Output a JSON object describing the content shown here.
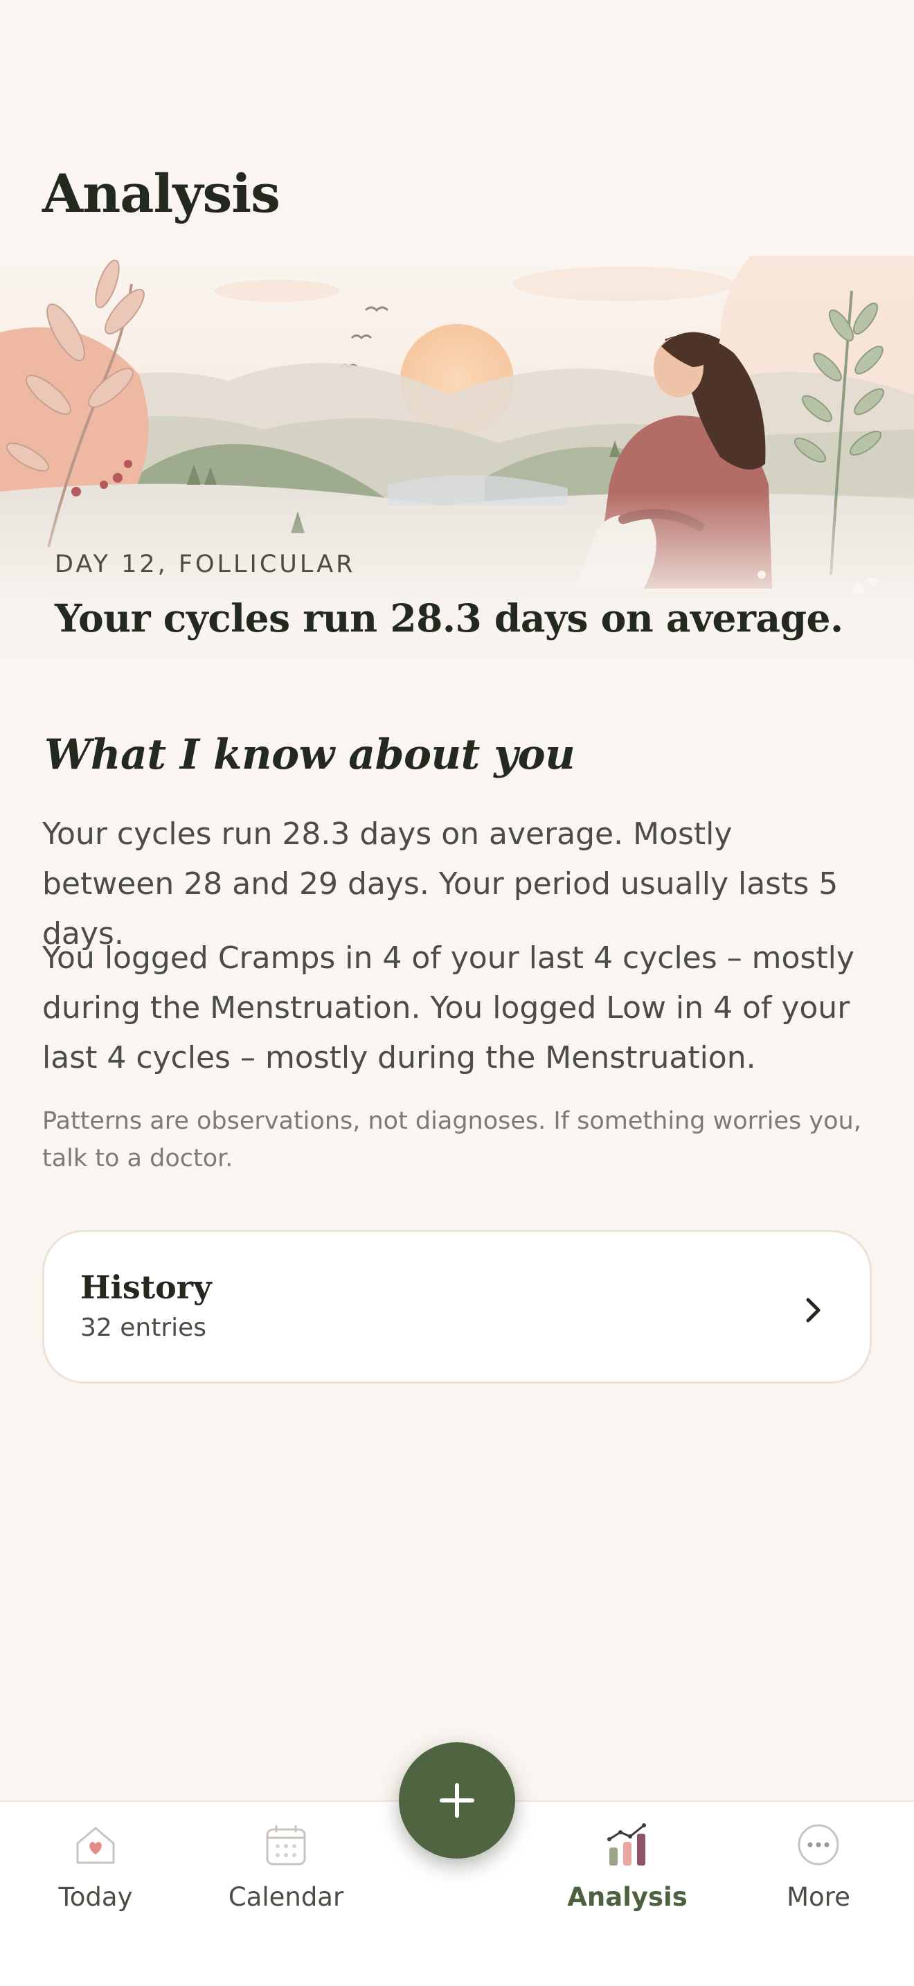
{
  "page": {
    "title": "Analysis"
  },
  "hero": {
    "eyebrow": "DAY 12, FOLLICULAR",
    "headline": "Your cycles run 28.3 days on average."
  },
  "insights": {
    "title": "What I know about you",
    "paragraph_1": "Your cycles run 28.3 days on average. Mostly between 28 and 29 days. Your period usually lasts 5 days.",
    "paragraph_2": "You logged Cramps in 4 of your last 4 cycles – mostly during the Menstruation. You logged Low in 4 of your last 4 cycles – mostly during the Menstruation.",
    "disclaimer": "Patterns are observations, not diagnoses. If something worries you, talk to a doctor."
  },
  "history": {
    "title": "History",
    "subtitle": "32 entries",
    "icon": "chevron-right-icon"
  },
  "tabbar": {
    "tabs": [
      {
        "label": "Today",
        "icon": "house-heart-icon",
        "active": false
      },
      {
        "label": "Calendar",
        "icon": "calendar-icon",
        "active": false
      },
      {
        "label": "Analysis",
        "icon": "bar-chart-icon",
        "active": true
      },
      {
        "label": "More",
        "icon": "more-dots-icon",
        "active": false
      }
    ],
    "fab_icon": "plus-icon"
  },
  "colors": {
    "background": "#faf5f0",
    "accent": "#4f6440",
    "text_dark": "#23291f",
    "text_body": "#4a4d44"
  }
}
